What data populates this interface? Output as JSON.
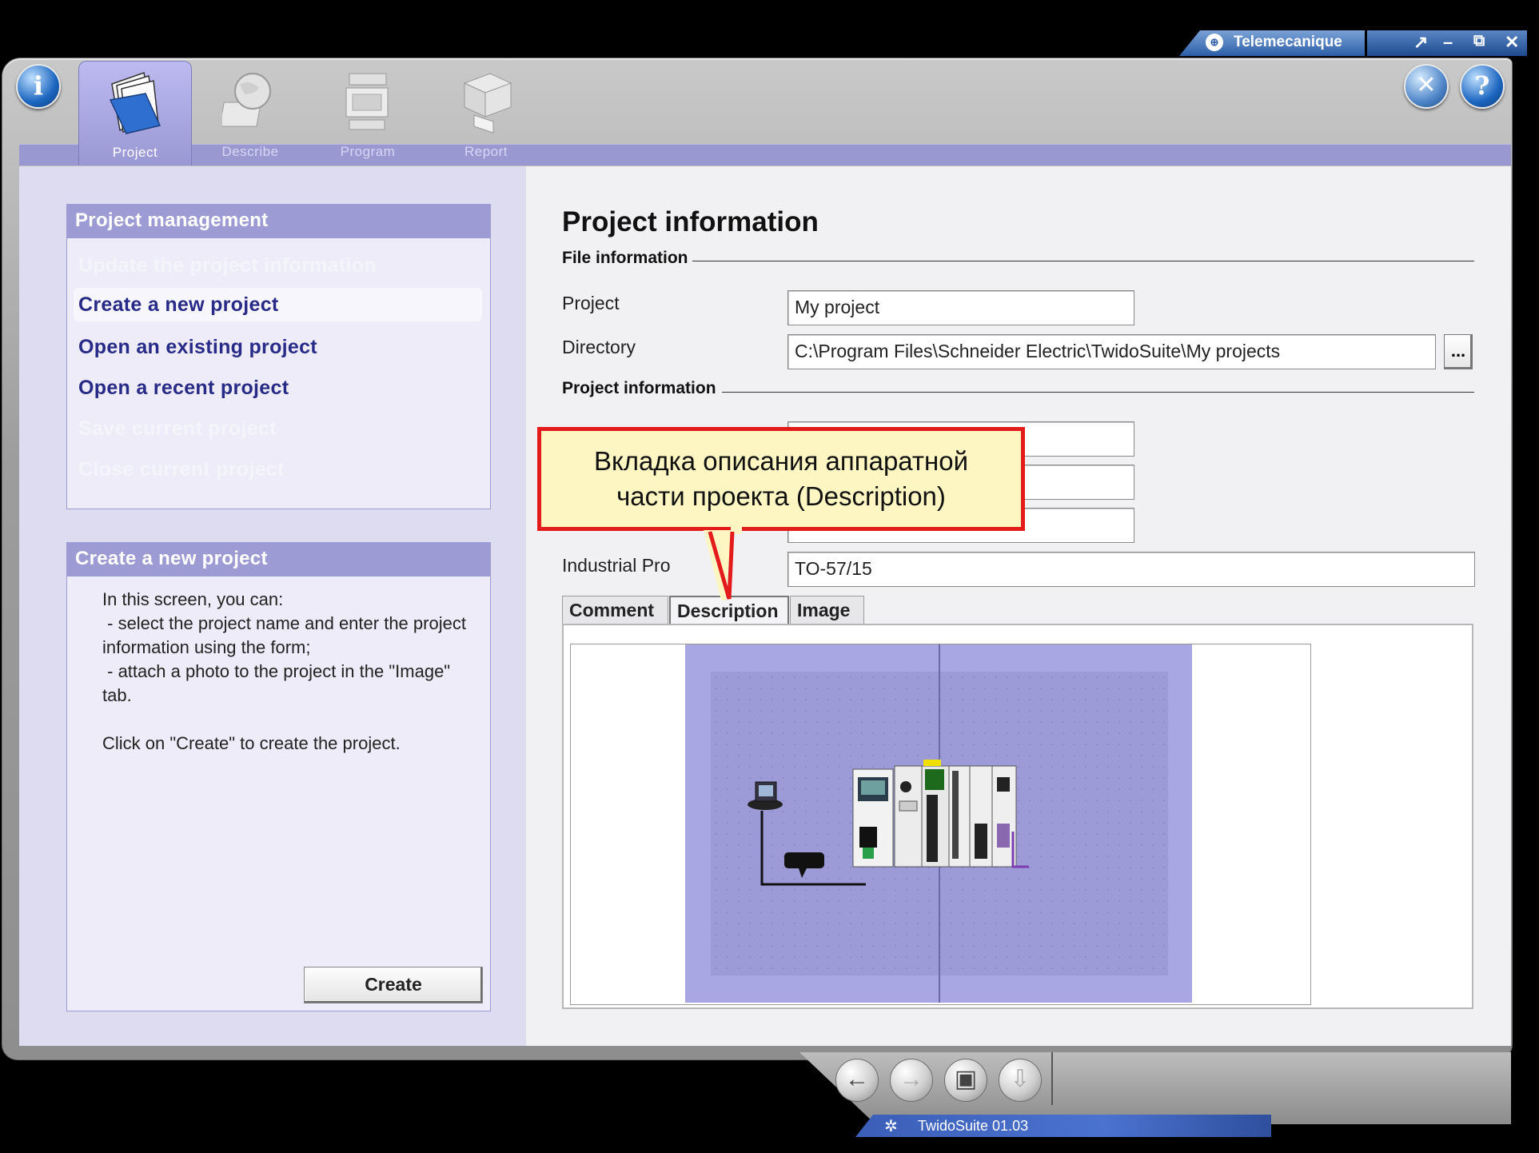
{
  "window": {
    "brand": "Telemecanique",
    "status_text": "TwidoSuite 01.03"
  },
  "top_tabs": [
    {
      "label": "Project",
      "icon": "project-folder-icon",
      "active": true
    },
    {
      "label": "Describe",
      "icon": "describe-globe-icon",
      "active": false
    },
    {
      "label": "Program",
      "icon": "program-icon",
      "active": false
    },
    {
      "label": "Report",
      "icon": "report-printer-icon",
      "active": false
    }
  ],
  "left": {
    "management": {
      "header": "Project management",
      "items": [
        {
          "label": "Update the project information",
          "enabled": false
        },
        {
          "label": "Create a new project",
          "enabled": true,
          "selected": true
        },
        {
          "label": "Open an existing project",
          "enabled": true
        },
        {
          "label": "Open a recent project",
          "enabled": true
        },
        {
          "label": "Save current project",
          "enabled": false
        },
        {
          "label": "Close current project",
          "enabled": false
        }
      ]
    },
    "help": {
      "header": "Create a new project",
      "text": "In this screen, you can:\n - select the project name and enter the project information using the form;\n - attach a photo to the project in the \"Image\" tab.\n\nClick on \"Create\" to create the project.",
      "create_label": "Create"
    }
  },
  "right": {
    "title": "Project information",
    "file_section": "File information",
    "project_label": "Project",
    "project_value": "My project",
    "directory_label": "Directory",
    "directory_value": "C:\\Program Files\\Schneider Electric\\TwidoSuite\\My projects",
    "browse_label": "...",
    "project_section": "Project information",
    "industrial_label": "Industrial Pro",
    "industrial_value": "TO-57/15",
    "subtabs": [
      "Comment",
      "Description",
      "Image"
    ]
  },
  "callout": {
    "line1": "Вкладка описания аппаратной",
    "line2": "части проекта (Description)"
  },
  "colors": {
    "accent": "#9d9bd4",
    "link": "#272b87",
    "callout_border": "#e41b1b",
    "callout_fill": "#fef6c2"
  }
}
